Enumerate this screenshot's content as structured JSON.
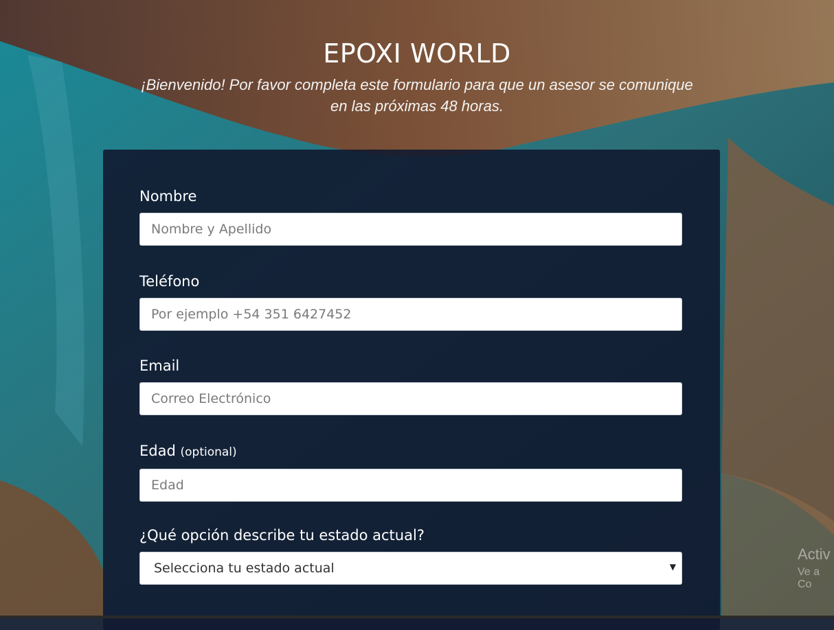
{
  "page": {
    "title": "EPOXI WORLD",
    "subtitle": "¡Bienvenido! Por favor completa este formulario para que un asesor se comunique en las próximas 48 horas."
  },
  "form": {
    "name": {
      "label": "Nombre",
      "placeholder": "Nombre y Apellido"
    },
    "phone": {
      "label": "Teléfono",
      "placeholder": "Por ejemplo +54 351 6427452"
    },
    "email": {
      "label": "Email",
      "placeholder": "Correo Electrónico"
    },
    "age": {
      "label": "Edad",
      "optional": "(optional)",
      "placeholder": "Edad"
    },
    "status": {
      "label": "¿Qué opción describe tu estado actual?",
      "selected": "Selecciona tu estado actual"
    }
  },
  "overlay": {
    "activate_line1": "Activ",
    "activate_line2": "Ve a Co"
  },
  "colors": {
    "panel": "#111a30",
    "teal": "#1f8a98",
    "rust": "#7a3a22"
  }
}
